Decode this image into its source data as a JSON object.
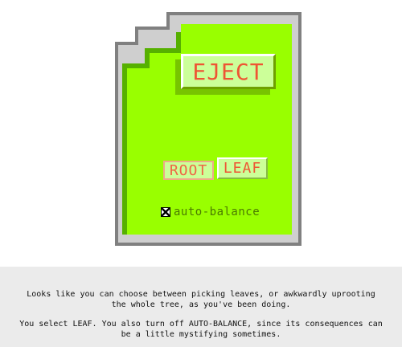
{
  "device": {
    "eject_label": "EJECT",
    "mode_buttons": {
      "root_label": "ROOT",
      "leaf_label": "LEAF",
      "selected": "LEAF"
    },
    "auto_balance": {
      "label": "auto-balance",
      "checked": false
    }
  },
  "narration": {
    "paragraph_1": "Looks like you can choose between picking leaves, or awkwardly uprooting the whole tree, as you've been doing.",
    "paragraph_2": "You select LEAF. You also turn off AUTO-BALANCE, since its consequences can be a little mystifying sometimes."
  },
  "colors": {
    "body": "#99ff00",
    "button_text": "#ee5533",
    "button_face": "#ccff99",
    "narration_bg": "#ebebeb"
  }
}
